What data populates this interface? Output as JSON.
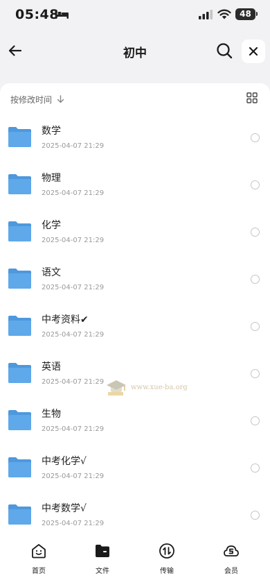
{
  "status_bar": {
    "time": "05:48",
    "battery": "48"
  },
  "header": {
    "title": "初中"
  },
  "sort": {
    "label": "按修改时间"
  },
  "files": [
    {
      "name": "数学",
      "date": "2025-04-07 21:29"
    },
    {
      "name": "物理",
      "date": "2025-04-07 21:29"
    },
    {
      "name": "化学",
      "date": "2025-04-07 21:29"
    },
    {
      "name": "语文",
      "date": "2025-04-07 21:29"
    },
    {
      "name": "中考资料✔",
      "date": "2025-04-07 21:29"
    },
    {
      "name": "英语",
      "date": "2025-04-07 21:29"
    },
    {
      "name": "生物",
      "date": "2025-04-07 21:29"
    },
    {
      "name": "中考化学√",
      "date": "2025-04-07 21:29"
    },
    {
      "name": "中考数学√",
      "date": "2025-04-07 21:29"
    }
  ],
  "watermark": "www.xue-ba.org",
  "tab_bar": {
    "tabs": [
      {
        "label": "首页",
        "icon": "home-smile-icon"
      },
      {
        "label": "文件",
        "icon": "folder-icon"
      },
      {
        "label": "传输",
        "icon": "transfer-icon"
      },
      {
        "label": "会员",
        "icon": "member-icon"
      }
    ],
    "active_index": 1
  },
  "colors": {
    "folder": "#5fa8ea",
    "page_bg": "#f2f2f4",
    "card_bg": "#ffffff"
  }
}
